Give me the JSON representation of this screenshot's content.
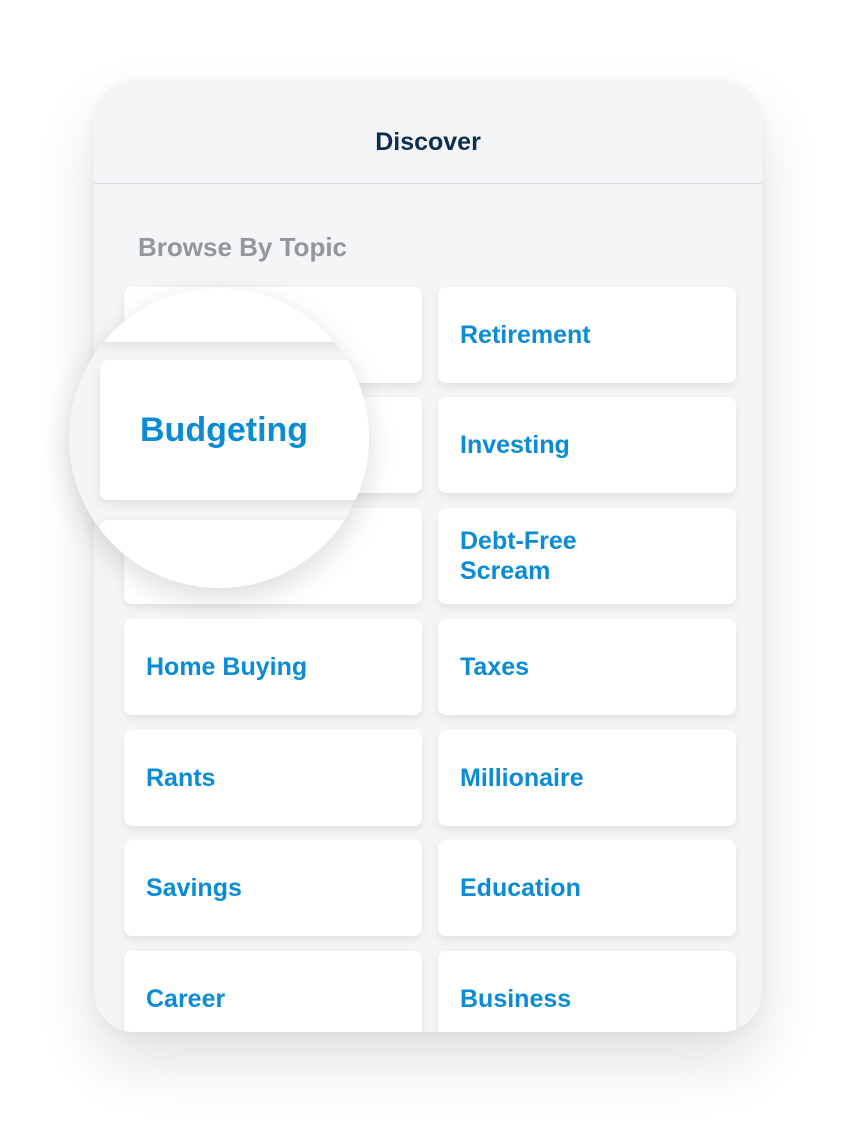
{
  "header": {
    "title": "Discover"
  },
  "section": {
    "label": "Browse By Topic"
  },
  "topics": [
    {
      "label": "Budgeting",
      "magnified": true
    },
    {
      "label": "Retirement"
    },
    {
      "label": ""
    },
    {
      "label": "Investing"
    },
    {
      "label": ""
    },
    {
      "label": "Debt-Free Scream"
    },
    {
      "label": "Home Buying"
    },
    {
      "label": "Taxes"
    },
    {
      "label": "Rants"
    },
    {
      "label": "Millionaire"
    },
    {
      "label": "Savings"
    },
    {
      "label": "Education"
    },
    {
      "label": "Career"
    },
    {
      "label": "Business"
    }
  ],
  "magnifier": {
    "label": "Budgeting"
  },
  "colors": {
    "accent": "#0a8bd6",
    "title": "#0d2d4f",
    "section_label": "#8e989e",
    "background": "#f4f5f7"
  }
}
